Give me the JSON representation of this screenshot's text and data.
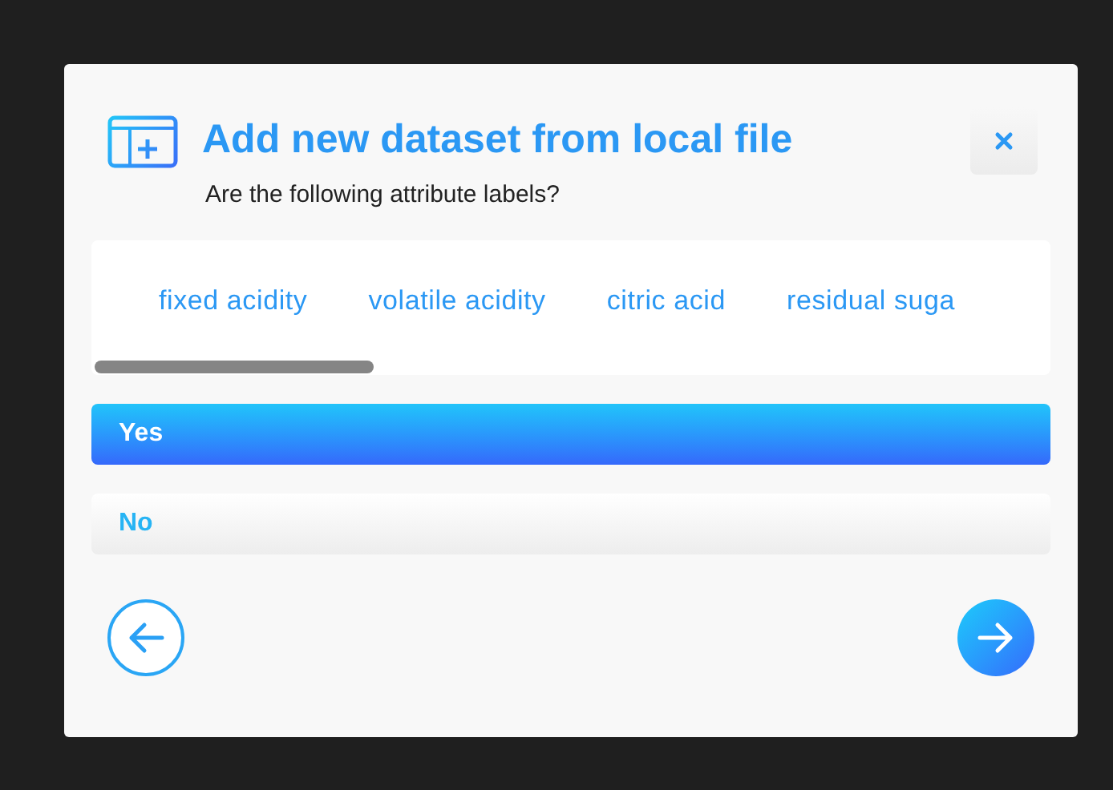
{
  "dialog": {
    "title": "Add new dataset from local file",
    "question": "Are the following attribute labels?"
  },
  "attributes": [
    "fixed acidity",
    "volatile acidity",
    "citric acid",
    "residual suga"
  ],
  "options": [
    {
      "label": "Yes",
      "selected": true
    },
    {
      "label": "No",
      "selected": false
    }
  ]
}
